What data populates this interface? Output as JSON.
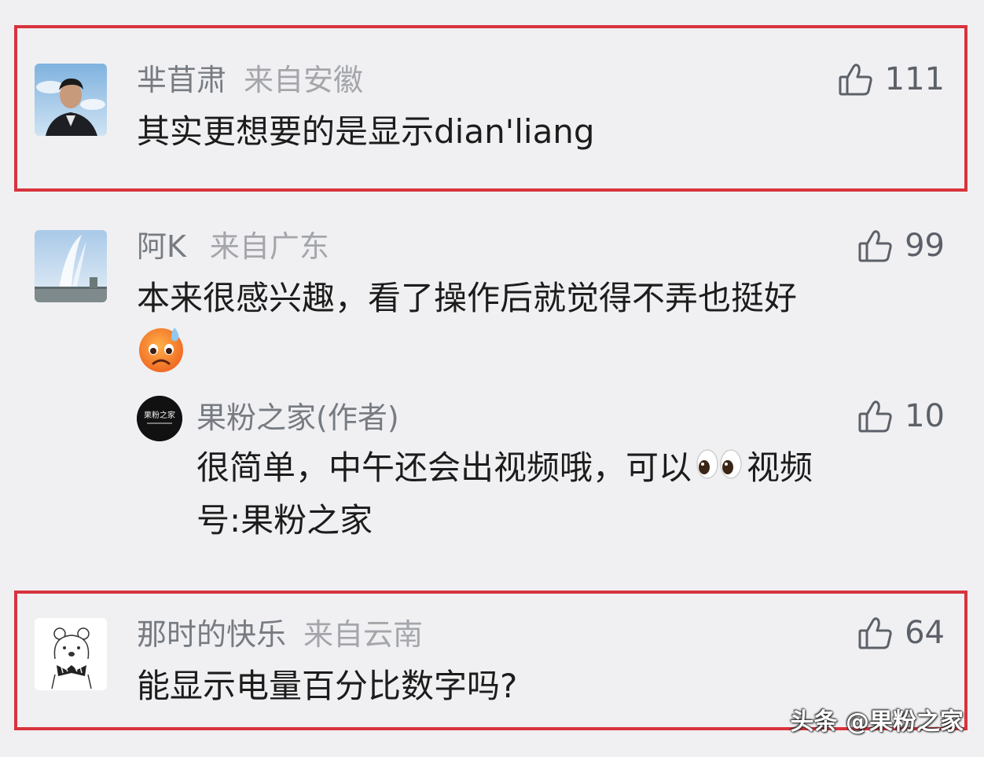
{
  "comments": [
    {
      "username": "芈苜肃",
      "location": "来自安徽",
      "likes": "111",
      "text": "其实更想要的是显示dian'liang",
      "highlighted": true
    },
    {
      "username": "阿K",
      "location": "来自广东",
      "likes": "99",
      "text_line1": "本来很感兴趣，看了操作后就觉得不弄也挺好",
      "highlighted": false,
      "reply": {
        "username": "果粉之家(作者)",
        "avatar_text": "果粉之家",
        "likes": "10",
        "text_line1_a": "很简单，中午还会出视频哦，可以",
        "text_line1_b": "视频",
        "text_line2": "号:果粉之家"
      }
    },
    {
      "username": "那时的快乐",
      "location": "来自云南",
      "likes": "64",
      "text": "能显示电量百分比数字吗?",
      "highlighted": true
    }
  ],
  "watermark": "头条 @果粉之家",
  "colors": {
    "highlight_border": "#d8333d",
    "background": "#f0f0f2",
    "username": "#777b82",
    "location": "#a4a6ab"
  },
  "icons": [
    "thumbs-up-icon",
    "worried-face-emoji",
    "eyes-emoji"
  ]
}
